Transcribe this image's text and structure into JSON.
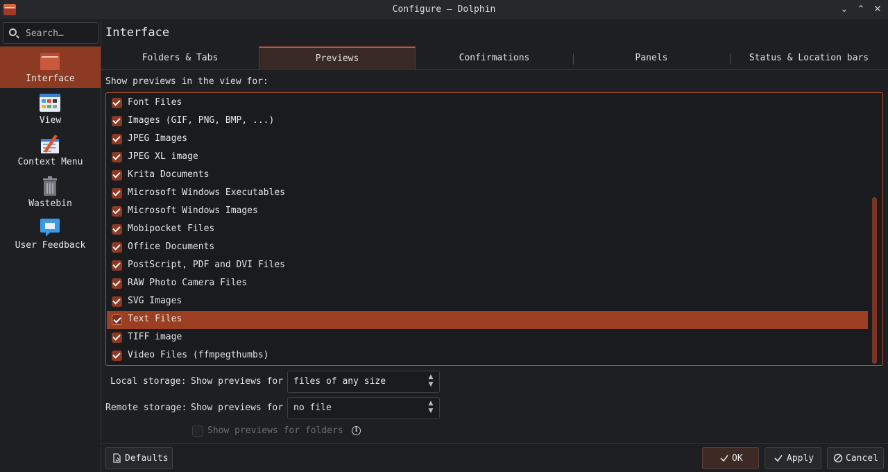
{
  "window": {
    "title": "Configure — Dolphin"
  },
  "sidebar": {
    "search_placeholder": "Search…",
    "items": [
      {
        "label": "Interface",
        "icon": "folder-icon"
      },
      {
        "label": "View",
        "icon": "view-icon"
      },
      {
        "label": "Context Menu",
        "icon": "context-menu-icon"
      },
      {
        "label": "Wastebin",
        "icon": "trash-icon"
      },
      {
        "label": "User Feedback",
        "icon": "feedback-icon"
      }
    ]
  },
  "page": {
    "title": "Interface"
  },
  "tabs": [
    {
      "label": "Folders & Tabs"
    },
    {
      "label": "Previews"
    },
    {
      "label": "Confirmations"
    },
    {
      "label": "Panels"
    },
    {
      "label": "Status & Location bars"
    }
  ],
  "previews": {
    "section_label": "Show previews in the view for:",
    "items": [
      "Font Files",
      "Images (GIF, PNG, BMP, ...)",
      "JPEG Images",
      "JPEG XL image",
      "Krita Documents",
      "Microsoft Windows Executables",
      "Microsoft Windows Images",
      "Mobipocket Files",
      "Office Documents",
      "PostScript, PDF and DVI Files",
      "RAW Photo Camera Files",
      "SVG Images",
      "Text Files",
      "TIFF image",
      "Video Files (ffmpegthumbs)"
    ],
    "selected_item": "Text Files"
  },
  "storage": {
    "local_label": "Local storage:",
    "remote_label": "Remote storage:",
    "show_for_label": "Show previews for",
    "local_value": "files of any size",
    "remote_value": "no file",
    "folders_label": "Show previews for folders"
  },
  "buttons": {
    "defaults": "Defaults",
    "ok": "OK",
    "apply": "Apply",
    "cancel": "Cancel"
  },
  "colors": {
    "accent": "#9c3e22",
    "accent_border": "#b4502f"
  }
}
